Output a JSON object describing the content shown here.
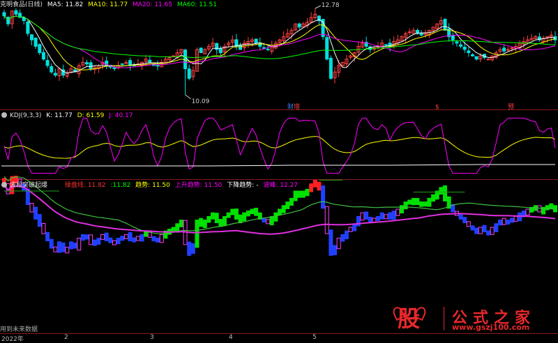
{
  "main_header": {
    "title": "克明食品(日线)",
    "ma5_label": "MA5:",
    "ma5": "11.82",
    "ma5_color": "#ffffff",
    "ma10_label": "MA10:",
    "ma10": "11.77",
    "ma10_color": "#ffff00",
    "ma20_label": "MA20:",
    "ma20": "11.65",
    "ma20_color": "#ff00ff",
    "ma60_label": "MA60:",
    "ma60": "11.51",
    "ma60_color": "#00ff00"
  },
  "price_markers": {
    "high": "12.78",
    "low": "10.09",
    "tag1": "财",
    "tag2": "增",
    "tag3": "$",
    "tag4": "预"
  },
  "kdj_header": {
    "title": "KDJ(9,3,3)",
    "k_label": "K:",
    "k": "11.77",
    "k_color": "#ffffff",
    "d_label": "D:",
    "d": "61.59",
    "d_color": "#ffff00",
    "j_label": "J:",
    "j": "40.17",
    "j_color": "#ff00ff"
  },
  "ind_header": {
    "title": "波段突破起爆",
    "caopan_label": "操盘线:",
    "caopan": "11.82",
    "caopan2": ":11.82",
    "trend_label": "趋势:",
    "trend": "11.50",
    "up_label": "上升趋势:",
    "up": "11.50",
    "down_label": "下降趋势:",
    "down": "-",
    "band_label": "波峰:",
    "band": "12.27"
  },
  "footer_note": "用到未来数据",
  "x_axis": {
    "year": "2022年",
    "m2": "2",
    "m3": "3",
    "m4": "4",
    "m5": "5"
  },
  "watermark": {
    "logo": "股",
    "name": "公式之家",
    "url": "www.gszj100.com"
  },
  "chart_data": [
    {
      "type": "candlestick",
      "title": "克明食品(日线)",
      "y_marks": {
        "high": 12.78,
        "low": 10.09
      },
      "series": [
        {
          "name": "MA5",
          "value": 11.82
        },
        {
          "name": "MA10",
          "value": 11.77
        },
        {
          "name": "MA20",
          "value": 11.65
        },
        {
          "name": "MA60",
          "value": 11.51
        }
      ],
      "close": [
        12.55,
        12.3,
        12.7,
        12.6,
        12.5,
        12.4,
        12.0,
        11.8,
        11.6,
        11.4,
        11.2,
        11.0,
        10.8,
        10.7,
        10.9,
        10.7,
        10.75,
        10.9,
        10.8,
        11.0,
        11.1,
        11.05,
        10.9,
        10.95,
        11.0,
        11.1,
        11.0,
        10.95,
        10.9,
        11.0,
        11.05,
        11.1,
        11.0,
        11.0,
        11.05,
        11.1,
        11.2,
        11.1,
        11.0,
        11.0,
        11.1,
        11.2,
        11.25,
        11.3,
        11.4,
        11.5,
        10.9,
        10.6,
        10.85,
        11.5,
        11.4,
        11.5,
        11.6,
        11.7,
        11.5,
        11.4,
        11.6,
        11.7,
        11.8,
        11.6,
        11.5,
        11.7,
        11.75,
        11.8,
        11.7,
        11.6,
        11.55,
        11.5,
        11.6,
        11.7,
        11.8,
        11.9,
        12.0,
        12.1,
        12.3,
        12.2,
        12.3,
        12.35,
        12.5,
        12.6,
        12.4,
        11.9,
        11.2,
        10.6,
        10.8,
        11.0,
        11.1,
        11.2,
        11.3,
        11.4,
        11.6,
        11.7,
        11.6,
        11.5,
        11.55,
        11.6,
        11.7,
        11.65,
        11.6,
        11.75,
        11.8,
        11.9,
        12.0,
        12.05,
        12.1,
        12.0,
        11.95,
        12.0,
        12.1,
        12.2,
        12.3,
        12.4,
        12.1,
        11.9,
        11.8,
        11.7,
        11.6,
        11.5,
        11.4,
        11.3,
        11.2,
        11.3,
        11.25,
        11.2,
        11.3,
        11.4,
        11.5,
        11.45,
        11.5,
        11.55,
        11.6,
        11.7,
        11.75,
        11.8,
        11.85,
        11.9,
        11.8,
        11.85,
        11.9,
        11.95,
        11.8
      ]
    },
    {
      "type": "line",
      "title": "KDJ(9,3,3)",
      "ylim": [
        0,
        100
      ],
      "series": [
        {
          "name": "K",
          "last": 11.77
        },
        {
          "name": "D",
          "last": 61.59
        },
        {
          "name": "J",
          "last": 40.17
        }
      ]
    },
    {
      "type": "bar",
      "title": "波段突破起爆",
      "series": [
        {
          "name": "操盘线",
          "last": 11.82
        },
        {
          "name": "趋势",
          "last": 11.5
        },
        {
          "name": "上升趋势",
          "last": 11.5
        },
        {
          "name": "下降趋势",
          "last": "-"
        },
        {
          "name": "波峰",
          "last": 12.27
        }
      ]
    }
  ]
}
